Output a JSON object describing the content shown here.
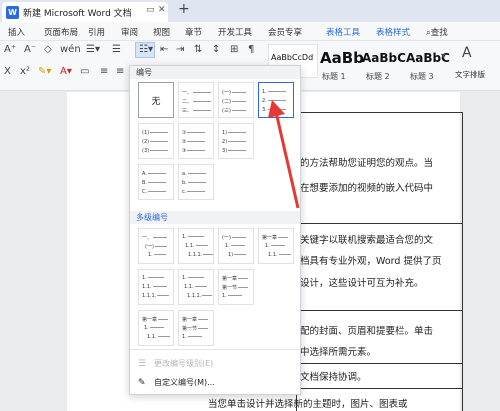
{
  "titlebar": {
    "app_logo": "W",
    "doc_title": "新建 Microsoft Word 文档",
    "new_tab": "+"
  },
  "menu": {
    "items": [
      "插入",
      "页面布局",
      "引用",
      "审阅",
      "视图",
      "章节",
      "开发工具",
      "会员专享"
    ],
    "context_items": [
      "表格工具",
      "表格样式"
    ],
    "search_label": "查找"
  },
  "toolbar": {
    "styles": [
      {
        "sample": "AaBbCcDd",
        "label": "正文"
      },
      {
        "sample": "AaBb",
        "label": "标题 1"
      },
      {
        "sample": "AaBbC",
        "label": "标题 2"
      },
      {
        "sample": "AaBbC",
        "label": "标题 3"
      }
    ],
    "text_layout_label": "文字排版"
  },
  "dropdown": {
    "numbering_header": "编号",
    "none_label": "无",
    "numbering_options": [
      [
        "一、",
        "二、",
        "三、"
      ],
      [
        "(一)",
        "(二)",
        "(三)"
      ],
      [
        "1.",
        "2.",
        "3."
      ],
      [
        "(1)",
        "(2)",
        "(3)"
      ],
      [
        "①",
        "②",
        "③"
      ],
      [
        "1)",
        "2)",
        "3)"
      ],
      [
        "A.",
        "B.",
        "C."
      ],
      [
        "a.",
        "b.",
        "c."
      ]
    ],
    "multilevel_header": "多级编号",
    "multilevel_options": [
      [
        "一、",
        "(一)",
        "1."
      ],
      [
        "1.",
        "1.1.",
        "1.1.1."
      ],
      [
        "(一)",
        "1.",
        "1)"
      ],
      [
        "第一章",
        "1.",
        "1.1."
      ],
      [
        "1.",
        "1.1.",
        "1.1.1."
      ],
      [
        "1.",
        "1.1.",
        "1.1.1."
      ],
      [
        "第一章",
        "第一节",
        "1."
      ],
      [
        "第一章",
        "1.",
        "1.1."
      ],
      [
        "第一章",
        "第一节",
        "1."
      ]
    ],
    "change_level": "更改编号级别(E)",
    "custom": "自定义编号(M)..."
  },
  "document": {
    "lines": [
      "的方法帮助您证明您的观点。当",
      "在想要添加的视频的嵌入代码中",
      "关键字以联机搜索最适合您的文",
      "档具有专业外观，Word 提供了页",
      "设计，这些设计可互为补充。",
      "配的封面、页眉和提要栏。单击",
      "中选择所需元素。",
      "文档保持协调。",
      "当您单击设计并选择新的主题时，图片、图表或"
    ]
  },
  "colors": {
    "accent": "#2b68e2",
    "selected_border": "#2b68e2",
    "arrow": "#e53935"
  }
}
